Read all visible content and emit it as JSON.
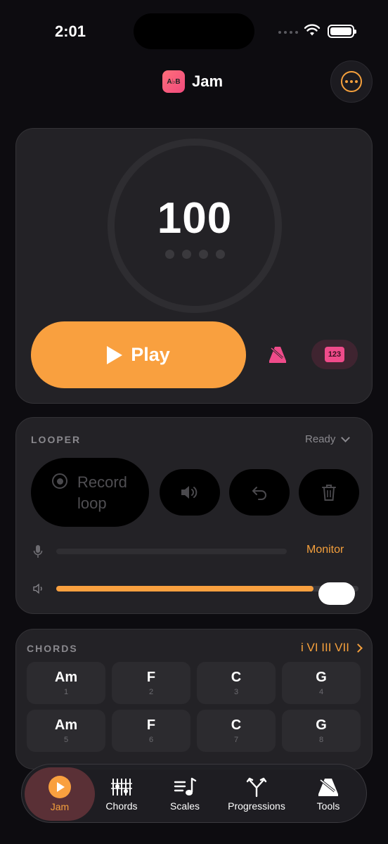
{
  "status": {
    "time": "2:01"
  },
  "header": {
    "title": "Jam",
    "logo_text": "A♭B"
  },
  "metronome": {
    "tempo": "100",
    "play_label": "Play",
    "counter_label": "123"
  },
  "looper": {
    "section_label": "LOOPER",
    "status": "Ready",
    "record_label": "Record loop",
    "monitor_label": "Monitor",
    "volume_fraction": 0.85
  },
  "chords": {
    "section_label": "CHORDS",
    "progression": "i VI III VII",
    "items": [
      {
        "name": "Am",
        "num": "1"
      },
      {
        "name": "F",
        "num": "2"
      },
      {
        "name": "C",
        "num": "3"
      },
      {
        "name": "G",
        "num": "4"
      },
      {
        "name": "Am",
        "num": "5"
      },
      {
        "name": "F",
        "num": "6"
      },
      {
        "name": "C",
        "num": "7"
      },
      {
        "name": "G",
        "num": "8"
      }
    ]
  },
  "tabs": [
    {
      "label": "Jam",
      "active": true
    },
    {
      "label": "Chords"
    },
    {
      "label": "Scales"
    },
    {
      "label": "Progressions"
    },
    {
      "label": "Tools"
    }
  ],
  "colors": {
    "accent": "#f9a03f",
    "pink": "#ef4b8a",
    "background": "#0d0c10",
    "card": "#232226"
  }
}
